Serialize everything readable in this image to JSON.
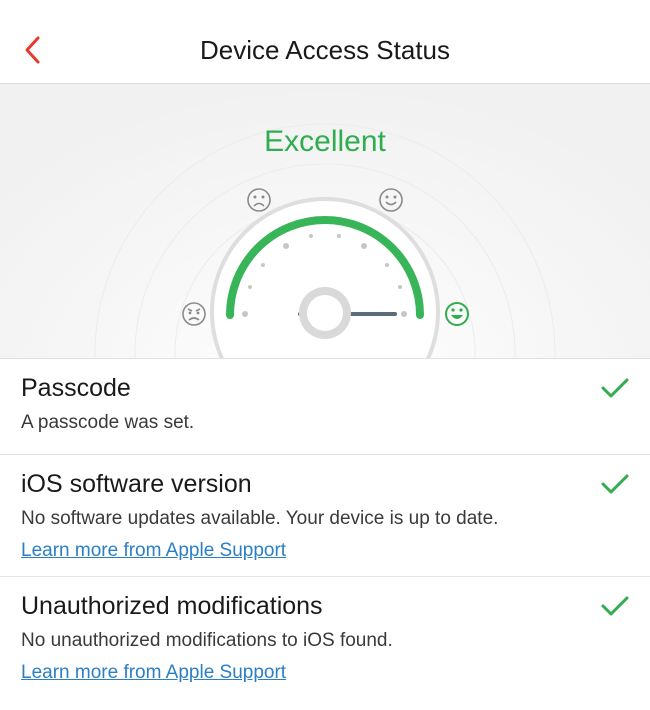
{
  "nav": {
    "title": "Device Access Status",
    "back_icon": "chevron-left-icon",
    "accent_color": "#e8392f"
  },
  "gauge": {
    "status": "Excellent",
    "status_color": "#2fad4f",
    "level": 1.0,
    "faces": [
      "angry-face-icon",
      "sad-face-icon",
      "happy-face-icon",
      "grinning-face-icon"
    ],
    "active_face": "grinning-face-icon"
  },
  "checks": [
    {
      "title": "Passcode",
      "description": "A passcode was set.",
      "status_icon": "checkmark-icon"
    },
    {
      "title": "iOS software version",
      "description": "No software updates available. Your device is up to date.",
      "link": "Learn more from Apple Support",
      "status_icon": "checkmark-icon"
    },
    {
      "title": "Unauthorized modifications",
      "description": "No unauthorized modifications to iOS found.",
      "link": "Learn more from Apple Support",
      "status_icon": "checkmark-icon"
    }
  ]
}
